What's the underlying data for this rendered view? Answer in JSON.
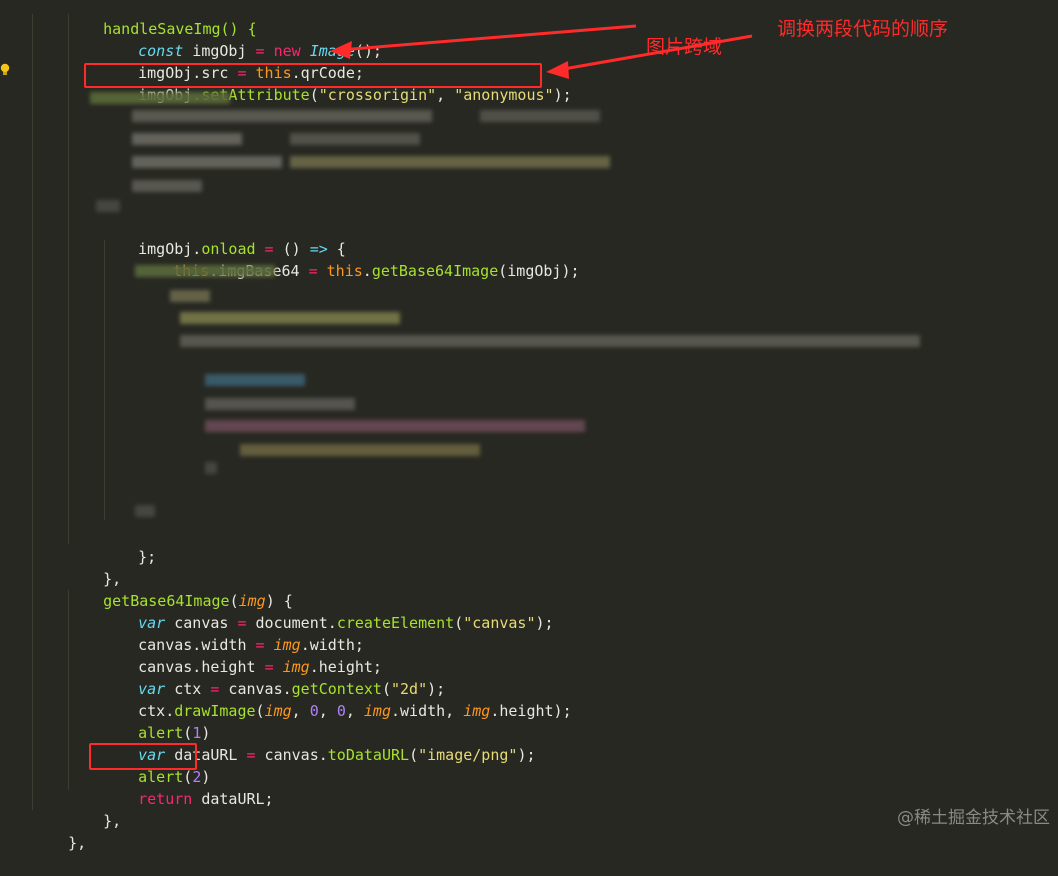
{
  "code": {
    "l1": "handleSaveImg() {",
    "l2_kw": "const",
    "l2_var": " imgObj ",
    "l2_eq": "=",
    "l2_new": " new ",
    "l2_cls": "Image",
    "l2_end": "();",
    "l3_a": "imgObj.src ",
    "l3_eq": "=",
    "l3_this": " this",
    "l3_b": ".qrCode;",
    "l4_a": "imgObj.",
    "l4_fn": "setAttribute",
    "l4_p": "(",
    "l4_s1": "\"crossorigin\"",
    "l4_c": ", ",
    "l4_s2": "\"anonymous\"",
    "l4_e": ");",
    "l5_a": "imgObj.",
    "l5_fn": "onload",
    "l5_eq": " = ",
    "l5_b": "() ",
    "l5_arrow": "=>",
    "l5_c": " {",
    "l6_this": "this",
    "l6_a": ".imgBase64 ",
    "l6_eq": "=",
    "l6_this2": " this",
    "l6_b": ".",
    "l6_fn": "getBase64Image",
    "l6_c": "(imgObj);",
    "l7": "};",
    "l8": "},",
    "l9_fn": "getBase64Image",
    "l9_p": "(",
    "l9_param": "img",
    "l9_e": ") {",
    "l10_kw": "var",
    "l10_a": " canvas ",
    "l10_eq": "=",
    "l10_b": " document.",
    "l10_fn": "createElement",
    "l10_p": "(",
    "l10_s": "\"canvas\"",
    "l10_e": ");",
    "l11_a": "canvas.width ",
    "l11_eq": "=",
    "l11_param": " img",
    "l11_b": ".width;",
    "l12_a": "canvas.height ",
    "l12_eq": "=",
    "l12_param": " img",
    "l12_b": ".height;",
    "l13_kw": "var",
    "l13_a": " ctx ",
    "l13_eq": "=",
    "l13_b": " canvas.",
    "l13_fn": "getContext",
    "l13_p": "(",
    "l13_s": "\"2d\"",
    "l13_e": ");",
    "l14_a": "ctx.",
    "l14_fn": "drawImage",
    "l14_p": "(",
    "l14_param": "img",
    "l14_c1": ", ",
    "l14_n1": "0",
    "l14_c2": ", ",
    "l14_n2": "0",
    "l14_c3": ", ",
    "l14_param2": "img",
    "l14_b": ".width, ",
    "l14_param3": "img",
    "l14_e": ".height);",
    "l15_fn": "alert",
    "l15_p": "(",
    "l15_n": "1",
    "l15_e": ")",
    "l16_kw": "var",
    "l16_a": " dataURL ",
    "l16_eq": "=",
    "l16_b": " canvas.",
    "l16_fn": "toDataURL",
    "l16_p": "(",
    "l16_s": "\"image/png\"",
    "l16_e": ");",
    "l17_fn": "alert",
    "l17_p": "(",
    "l17_n": "2",
    "l17_e": ")",
    "l18_kw": "return",
    "l18_a": " dataURL;",
    "l19": "},",
    "l20": "},"
  },
  "annotations": {
    "swap_order": "调换两段代码的顺序",
    "cross_origin": "图片跨域"
  },
  "watermark": "@稀土掘金技术社区",
  "colors": {
    "background": "#272822",
    "keyword": "#f92672",
    "storage": "#66d9ef",
    "function": "#a6e22e",
    "string": "#e6db74",
    "number": "#ae81ff",
    "this": "#fd971f",
    "annotation": "#ff2a2a"
  },
  "icons": [
    "lightbulb-icon",
    "arrow-icon"
  ]
}
